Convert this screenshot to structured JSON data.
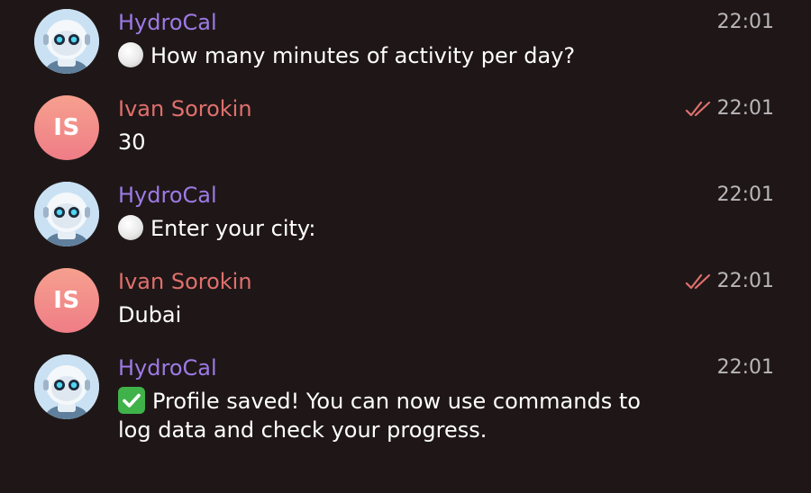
{
  "messages": [
    {
      "sender": "HydroCal",
      "time": "22:01",
      "text": "How many minutes of activity per day?"
    },
    {
      "sender": "Ivan Sorokin",
      "initials": "IS",
      "time": "22:01",
      "text": "30"
    },
    {
      "sender": "HydroCal",
      "time": "22:01",
      "text": "Enter your city:"
    },
    {
      "sender": "Ivan Sorokin",
      "initials": "IS",
      "time": "22:01",
      "text": "Dubai"
    },
    {
      "sender": "HydroCal",
      "time": "22:01",
      "text_line1": "Profile saved! You can now use commands to",
      "text_line2": "log data and check your progress."
    }
  ],
  "colors": {
    "background": "#1f1717",
    "bot_name": "#9d7ae6",
    "user_name": "#e0706d",
    "read_checks": "#e0706d",
    "timestamp": "#b9b6ba"
  },
  "icons": {
    "bot_avatar": "robot-avatar-icon",
    "read_status": "double-check-icon",
    "emoji_circle": "white-circle-emoji",
    "emoji_check": "check-mark-button-emoji"
  }
}
